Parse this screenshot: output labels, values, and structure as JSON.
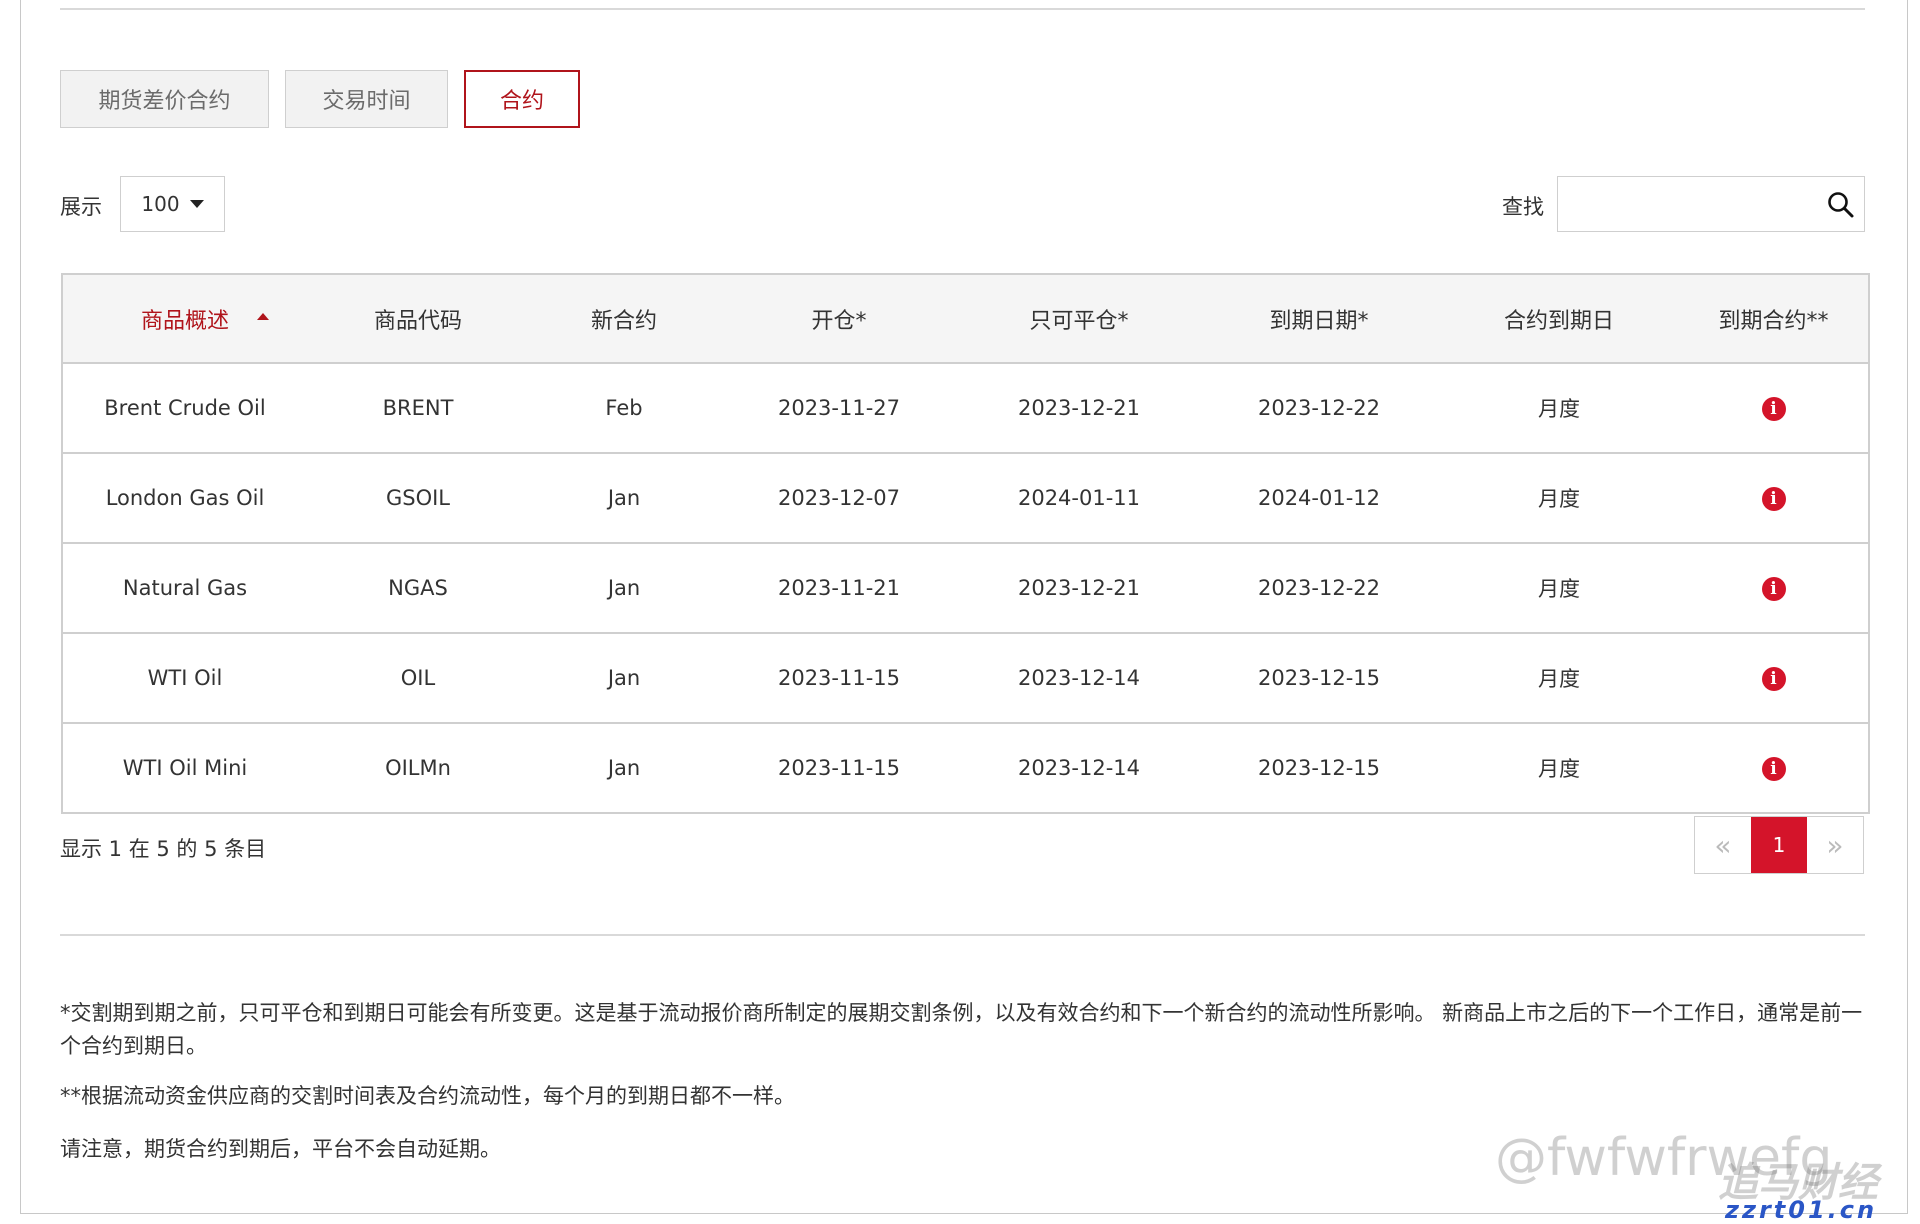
{
  "tabs": [
    {
      "label": "期货差价合约",
      "active": false
    },
    {
      "label": "交易时间",
      "active": false
    },
    {
      "label": "合约",
      "active": true
    }
  ],
  "controls": {
    "show_label": "展示",
    "page_length": "100",
    "search_label": "查找",
    "search_value": ""
  },
  "table": {
    "headers": [
      "商品概述",
      "商品代码",
      "新合约",
      "开仓*",
      "只可平仓*",
      "到期日期*",
      "合约到期日",
      "到期合约**"
    ],
    "rows": [
      {
        "name": "Brent Crude Oil",
        "code": "BRENT",
        "new": "Feb",
        "open": "2023-11-27",
        "close_only": "2023-12-21",
        "expiry": "2023-12-22",
        "period": "月度"
      },
      {
        "name": "London Gas Oil",
        "code": "GSOIL",
        "new": "Jan",
        "open": "2023-12-07",
        "close_only": "2024-01-11",
        "expiry": "2024-01-12",
        "period": "月度"
      },
      {
        "name": "Natural Gas",
        "code": "NGAS",
        "new": "Jan",
        "open": "2023-11-21",
        "close_only": "2023-12-21",
        "expiry": "2023-12-22",
        "period": "月度"
      },
      {
        "name": "WTI Oil",
        "code": "OIL",
        "new": "Jan",
        "open": "2023-11-15",
        "close_only": "2023-12-14",
        "expiry": "2023-12-15",
        "period": "月度"
      },
      {
        "name": "WTI Oil Mini",
        "code": "OILMn",
        "new": "Jan",
        "open": "2023-11-15",
        "close_only": "2023-12-14",
        "expiry": "2023-12-15",
        "period": "月度"
      }
    ]
  },
  "summary": "显示 1 在 5 的 5 条目",
  "pager": {
    "prev": "«",
    "current": "1",
    "next": "»"
  },
  "notes": [
    "*交割期到期之前，只可平仓和到期日可能会有所变更。这是基于流动报价商所制定的展期交割条例，以及有效合约和下一个新合约的流动性所影响。 新商品上市之后的下一个工作日，通常是前一个合约到期日。",
    "**根据流动资金供应商的交割时间表及合约流动性，每个月的到期日都不一样。",
    "请注意，期货合约到期后，平台不会自动延期。"
  ],
  "watermarks": {
    "handle": "@fwfwfrwefg",
    "brand": "追马财经",
    "site": "zzrt01.cn"
  },
  "colors": {
    "accent": "#b0141b",
    "badge": "#d4142a"
  }
}
